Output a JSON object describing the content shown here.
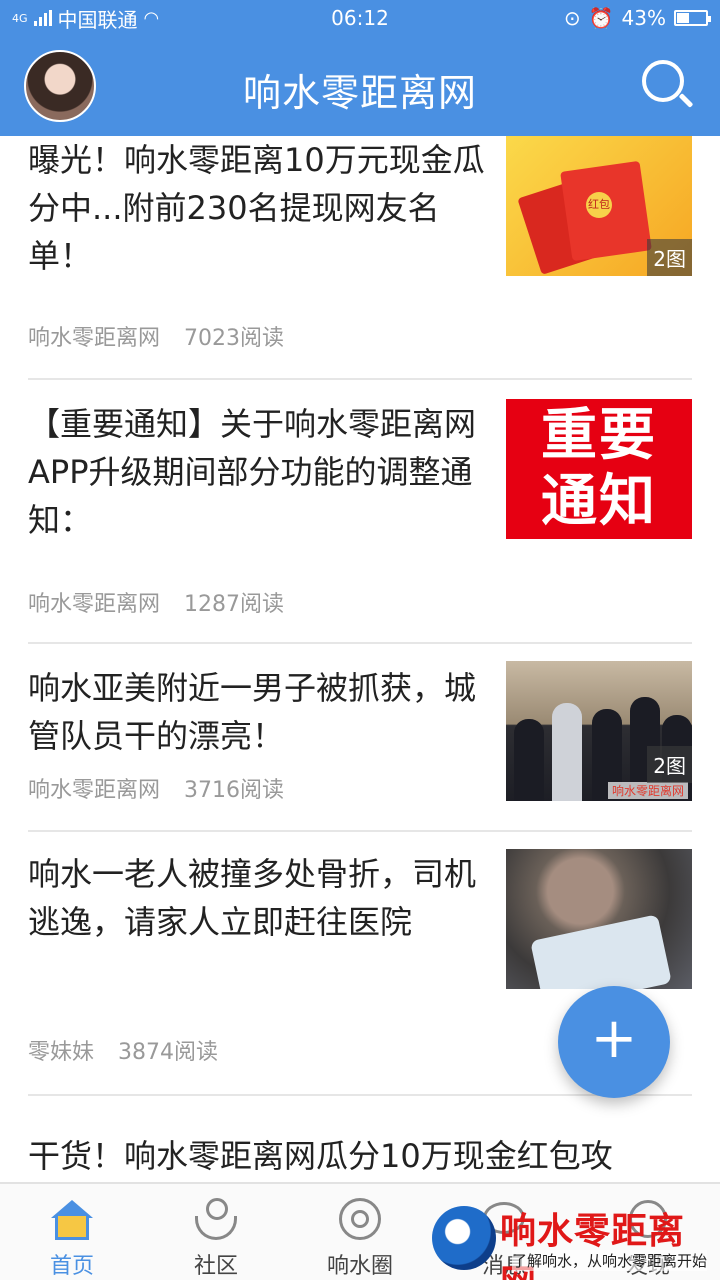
{
  "status_bar": {
    "network": "4G",
    "carrier": "中国联通",
    "time": "06:12",
    "battery": "43%",
    "battery_level": 0.43,
    "icons": [
      "signal-icon",
      "wifi-icon",
      "rotation-lock-icon",
      "alarm-icon",
      "battery-icon"
    ]
  },
  "header": {
    "title": "响水零距离网",
    "search_icon": "search-icon"
  },
  "articles": [
    {
      "title": "曝光！响水零距离10万元现金瓜分中...附前230名提现网友名单！",
      "source": "响水零距离网",
      "reads": "7023阅读",
      "badge": "2图",
      "thumb_text": "红包"
    },
    {
      "title": "【重要通知】关于响水零距离网APP升级期间部分功能的调整通知：",
      "source": "响水零距离网",
      "reads": "1287阅读",
      "thumb_text": "重要\n通知"
    },
    {
      "title": "响水亚美附近一男子被抓获，城管队员干的漂亮！",
      "source": "响水零距离网",
      "reads": "3716阅读",
      "badge": "2图",
      "thumb_text": "响水零距离网"
    },
    {
      "title": "响水一老人被撞多处骨折，司机逃逸，请家人立即赶往医院",
      "source": "零妹妹",
      "reads": "3874阅读"
    },
    {
      "title": "干货！响水零距离网瓜分10万现金红包攻"
    }
  ],
  "fab": {
    "label": "+"
  },
  "tabbar": {
    "tabs": [
      {
        "label": "首页",
        "icon": "home-icon",
        "active": true
      },
      {
        "label": "社区",
        "icon": "community-icon"
      },
      {
        "label": "响水圈",
        "icon": "circle-icon"
      },
      {
        "label": "消息",
        "icon": "message-icon"
      },
      {
        "label": "发现",
        "icon": "discover-icon"
      }
    ]
  },
  "watermark": {
    "title": "响水零距离网",
    "slogan": "了解响水，从响水零距离开始"
  },
  "colors": {
    "primary": "#4a90e2",
    "notice_red": "#e60012",
    "meta_gray": "#999999"
  }
}
